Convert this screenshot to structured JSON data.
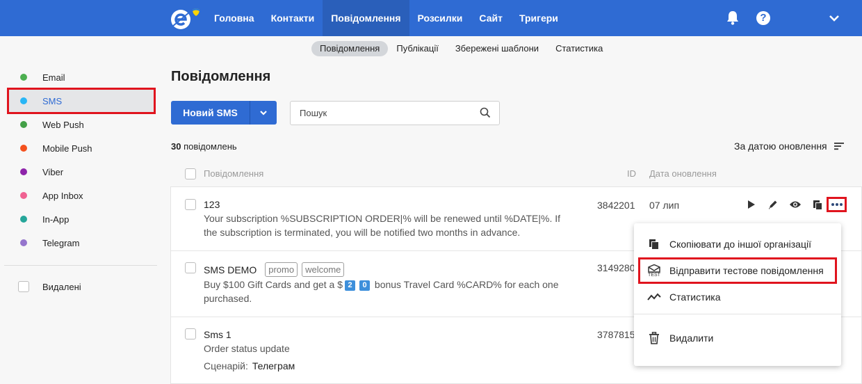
{
  "topnav": {
    "items": [
      "Головна",
      "Контакти",
      "Повідомлення",
      "Розсилки",
      "Сайт",
      "Тригери"
    ],
    "active_index": 2,
    "help_label": "?"
  },
  "subnav": {
    "items": [
      "Повідомлення",
      "Публікації",
      "Збережені шаблони",
      "Статистика"
    ],
    "active_index": 0
  },
  "sidebar": {
    "items": [
      {
        "label": "Email",
        "color": "#4caf50"
      },
      {
        "label": "SMS",
        "color": "#29b6f6"
      },
      {
        "label": "Web Push",
        "color": "#43a047"
      },
      {
        "label": "Mobile Push",
        "color": "#f4511e"
      },
      {
        "label": "Viber",
        "color": "#8e24aa"
      },
      {
        "label": "App Inbox",
        "color": "#f06292"
      },
      {
        "label": "In-App",
        "color": "#26a69a"
      },
      {
        "label": "Telegram",
        "color": "#9575cd"
      }
    ],
    "active_index": 1,
    "deleted_label": "Видалені"
  },
  "main": {
    "title": "Повідомлення",
    "new_button": "Новий SMS",
    "search_placeholder": "Пошук",
    "count_number": "30",
    "count_label": " повідомлень",
    "sort_label": "За датою оновлення",
    "headers": {
      "message": "Повідомлення",
      "id": "ID",
      "date": "Дата оновлення"
    }
  },
  "rows": [
    {
      "title": "123",
      "body": "Your subscription %SUBSCRIPTION ORDER|% will be renewed until %DATE|%. If the subscription is terminated, you will be notified two months in advance.",
      "id": "3842201",
      "date": "07 лип"
    },
    {
      "title": "SMS DEMO",
      "tags": [
        "promo",
        "welcome"
      ],
      "body_pre": "Buy $100 Gift Cards and get a $",
      "keycaps": [
        "2",
        "0"
      ],
      "body_post": " bonus Travel Card %CARD% for each one purchased.",
      "id": "3149280"
    },
    {
      "title": "Sms 1",
      "body": "Order status update",
      "id": "3787815",
      "scenario_label": "Сценарій:",
      "scenario_value": "Телеграм"
    }
  ],
  "menu": {
    "items": [
      {
        "label": "Скопіювати до іншої організації",
        "icon": "copy-icon"
      },
      {
        "label": "Відправити тестове повідомлення",
        "icon": "test-send-icon",
        "icon_text": "TEST"
      },
      {
        "label": "Статистика",
        "icon": "stats-icon"
      },
      {
        "label": "Видалити",
        "icon": "trash-icon"
      }
    ]
  },
  "colors": {
    "brand": "#2f6bd3",
    "highlight": "#e0141e"
  }
}
